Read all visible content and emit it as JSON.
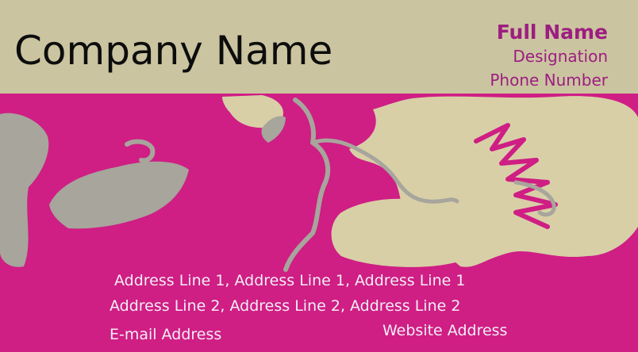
{
  "card": {
    "company_name": "Company Name",
    "full_name": "Full Name",
    "designation": "Designation",
    "phone": "Phone Number",
    "address_line_1": "Address Line 1,  Address Line 1,  Address Line 1",
    "address_line_2": "Address Line 2,  Address Line 2,  Address Line 2",
    "email": "E-mail Address",
    "website": "Website Address"
  },
  "colors": {
    "background_magenta": "#cf1e84",
    "header_beige": "#cbc4a0",
    "leaf_beige": "#d8cfa7",
    "leaf_gray": "#a7a59c",
    "name_purple": "#9c1e80",
    "text_dark": "#0d0d0d",
    "text_light": "#f5edf5"
  }
}
